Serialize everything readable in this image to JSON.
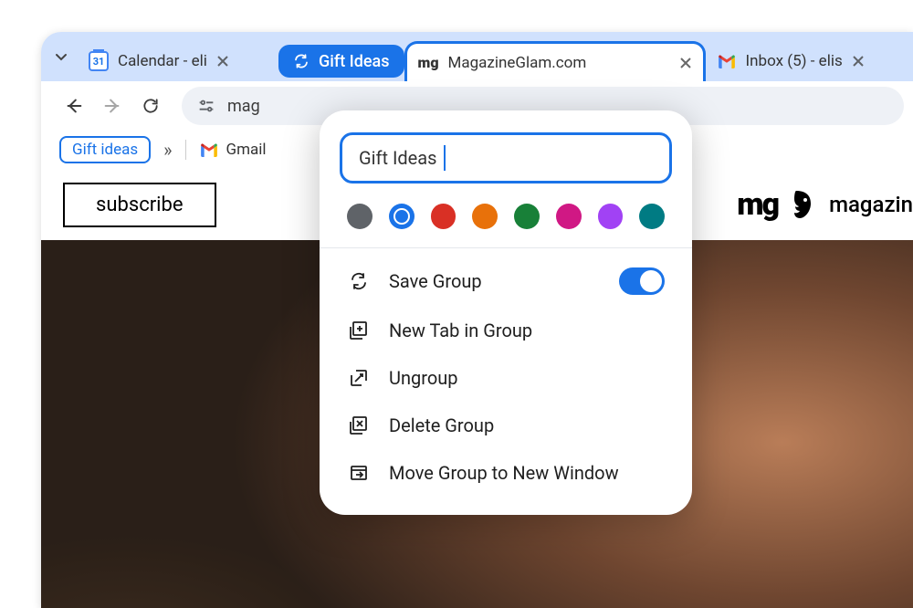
{
  "tabs": {
    "dropdown_icon": "chevron-down",
    "calendar": {
      "favicon_day": "31",
      "title": "Calendar - eli"
    },
    "group_label": "Gift Ideas",
    "active": {
      "favicon_text": "mg",
      "title": "MagazineGlam.com"
    },
    "inbox": {
      "title": "Inbox (5) - elis"
    }
  },
  "toolbar": {
    "omnibox_text": "mag"
  },
  "bookmarks": {
    "chip": "Gift ideas",
    "more": "»",
    "gmail": "Gmail"
  },
  "page": {
    "subscribe": "subscribe",
    "brand_mark": "mg",
    "brand_name": "magazin"
  },
  "popup": {
    "name_value": "Gift Ideas",
    "colors": [
      {
        "hex": "#5f6368",
        "selected": false
      },
      {
        "hex": "#1a73e8",
        "selected": true
      },
      {
        "hex": "#d93025",
        "selected": false
      },
      {
        "hex": "#e8710a",
        "selected": false
      },
      {
        "hex": "#188038",
        "selected": false
      },
      {
        "hex": "#c5221f",
        "selected": false,
        "override": "#d01884"
      },
      {
        "hex": "#a142f4",
        "selected": false
      },
      {
        "hex": "#007b83",
        "selected": false
      }
    ],
    "save_group": "Save Group",
    "save_on": true,
    "new_tab": "New Tab in Group",
    "ungroup": "Ungroup",
    "delete": "Delete Group",
    "move": "Move Group to New Window"
  }
}
